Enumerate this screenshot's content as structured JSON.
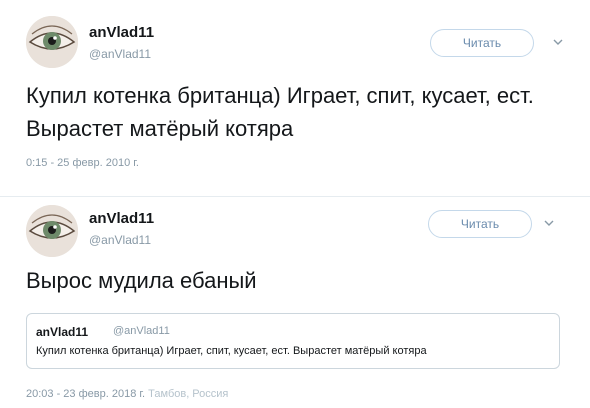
{
  "tweets": [
    {
      "author_name": "anVlad11",
      "handle": "@anVlad11",
      "read_button": "Читать",
      "text": "Купил котенка британца) Играет, спит, кусает, ест. Вырастет матёрый котяра",
      "timestamp": "0:15 - 25 февр. 2010 г.",
      "avatar_icon": "eye-avatar-icon",
      "menu_icon": "chevron-down-icon"
    },
    {
      "author_name": "anVlad11",
      "handle": "@anVlad11",
      "read_button": "Читать",
      "text": "Вырос мудила ебаный",
      "timestamp": "20:03 - 23 февр. 2018 г.",
      "location": "Тамбов, Россия",
      "avatar_icon": "eye-avatar-icon",
      "menu_icon": "chevron-down-icon",
      "quoted": {
        "author_name": "anVlad11",
        "handle": "@anVlad11",
        "text": "Купил котенка британца) Играет, спит, кусает, ест. Вырастет матёрый котяра"
      }
    }
  ],
  "colors": {
    "text": "#14171a",
    "secondary": "#8899a6",
    "button_border": "#c4d8ea",
    "button_text": "#6a8bad",
    "divider": "#e6ecf0"
  }
}
